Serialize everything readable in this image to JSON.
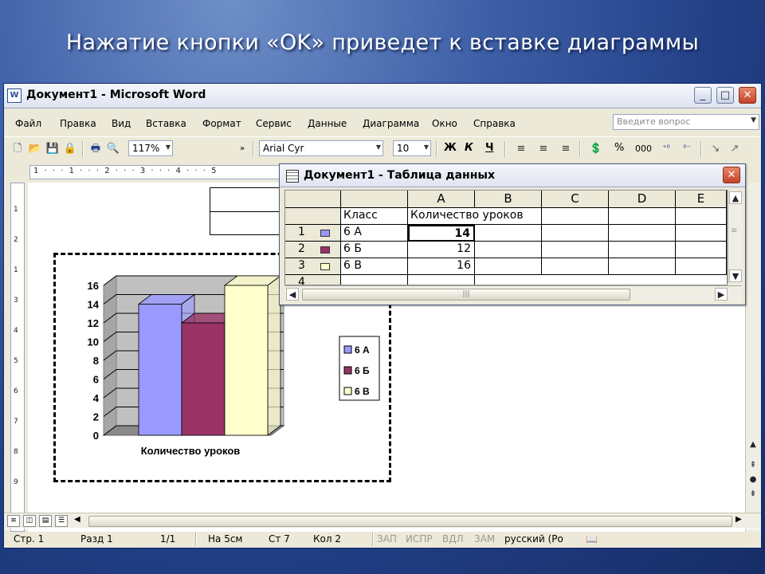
{
  "slide_title": "Нажатие кнопки «OK» приведет к вставке диаграммы",
  "window": {
    "title": "Документ1 - Microsoft Word",
    "minimize": "_",
    "maximize": "□",
    "close": "✕"
  },
  "menu": [
    "Файл",
    "Правка",
    "Вид",
    "Вставка",
    "Формат",
    "Сервис",
    "Данные",
    "Диаграмма",
    "Окно",
    "Справка"
  ],
  "ask_placeholder": "Введите вопрос",
  "toolbar": {
    "zoom": "117%",
    "font": "Arial Cyr",
    "font_size": "10",
    "bold": "Ж",
    "italic": "К",
    "underline": "Ч",
    "percent": "%",
    "thousands": "000"
  },
  "ruler_numbers": "1 · · · 1 · · · 2 · · · 3 · · · 4 · · · 5",
  "ruler_v_numbers": [
    "1",
    "2",
    "1",
    "3",
    "4",
    "5",
    "6",
    "7",
    "8",
    "9"
  ],
  "datasheet": {
    "title": "Документ1 - Таблица данных",
    "columns": [
      "A",
      "B",
      "C",
      "D",
      "E"
    ],
    "header_label": "Класс",
    "header_value": "Количество уроков",
    "rows": [
      {
        "num": "1",
        "label": "6 А",
        "value": "14"
      },
      {
        "num": "2",
        "label": "6 Б",
        "value": "12"
      },
      {
        "num": "3",
        "label": "6 В",
        "value": "16"
      },
      {
        "num": "4",
        "label": "",
        "value": ""
      }
    ],
    "series_colors": [
      "#9999ff",
      "#993366",
      "#ffffcc"
    ]
  },
  "chart_data": {
    "type": "bar",
    "categories": [
      "Количество уроков"
    ],
    "series": [
      {
        "name": "6 А",
        "values": [
          14
        ],
        "color": "#9999ff"
      },
      {
        "name": "6 Б",
        "values": [
          12
        ],
        "color": "#993366"
      },
      {
        "name": "6 В",
        "values": [
          16
        ],
        "color": "#ffffcc"
      }
    ],
    "y_ticks": [
      "0",
      "2",
      "4",
      "6",
      "8",
      "10",
      "12",
      "14",
      "16"
    ],
    "ylim": [
      0,
      16
    ],
    "grid": true,
    "legend": "right",
    "style": "3d-column",
    "xlabel": "Количество уроков"
  },
  "status": {
    "page": "Стр. 1",
    "section": "Разд 1",
    "pages": "1/1",
    "at": "На 5см",
    "line": "Ст 7",
    "col": "Кол 2",
    "rec": "ЗАП",
    "trk": "ИСПР",
    "ext": "ВДЛ",
    "ovr": "ЗАМ",
    "lang": "русский (Ро"
  }
}
